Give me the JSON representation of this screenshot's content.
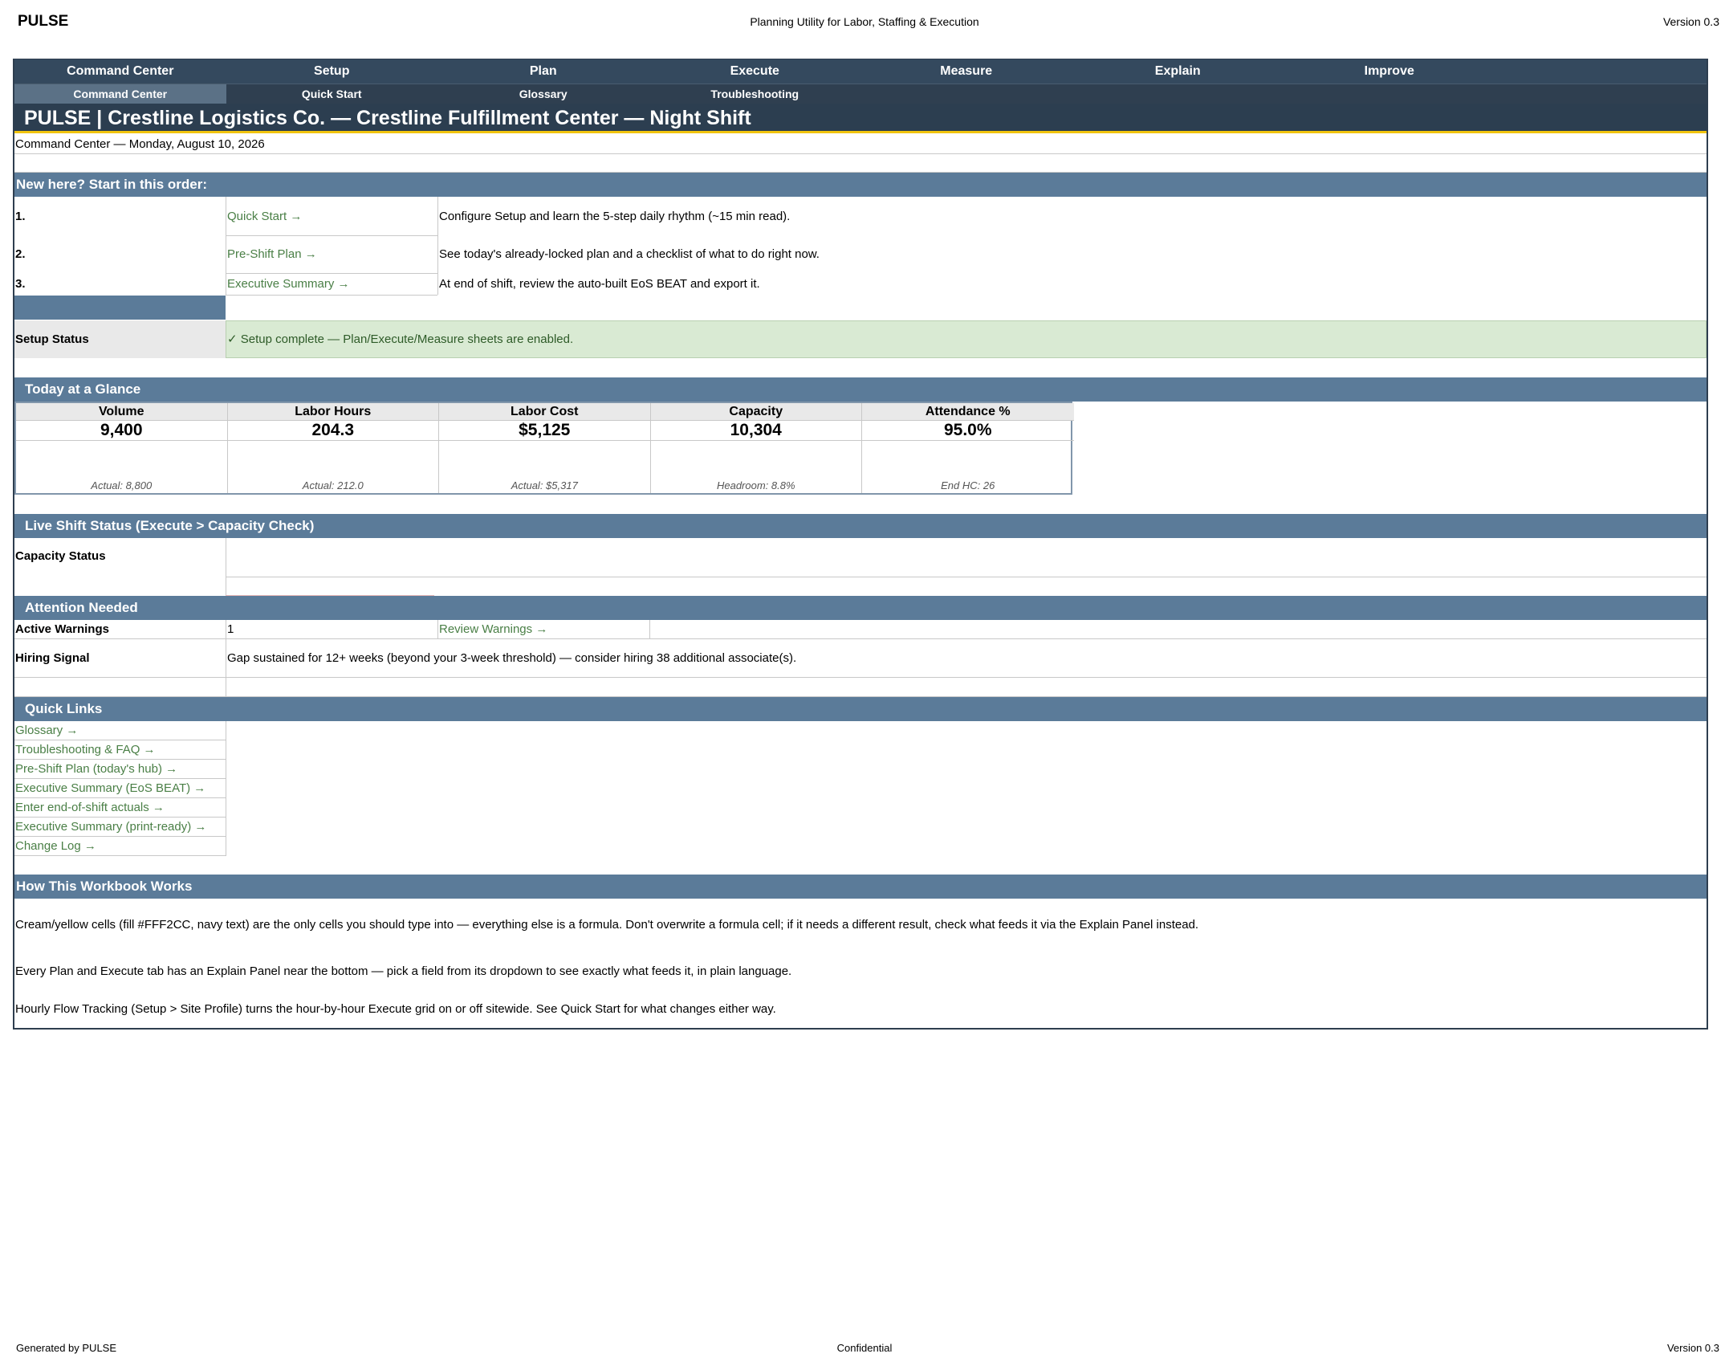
{
  "page_header": {
    "brand": "PULSE",
    "subtitle": "Planning Utility for Labor, Staffing & Execution",
    "version": "Version 0.3"
  },
  "page_footer": {
    "left": "Generated by PULSE",
    "center": "Confidential",
    "right": "Version 0.3"
  },
  "nav_primary": [
    "Command Center",
    "Setup",
    "Plan",
    "Execute",
    "Measure",
    "Explain",
    "Improve"
  ],
  "nav_secondary": [
    "Command Center",
    "Quick Start",
    "Glossary",
    "Troubleshooting"
  ],
  "nav_secondary_active": "Command Center",
  "title": "PULSE | Crestline Logistics Co. — Crestline Fulfillment Center — Night Shift",
  "date_line": "Command Center — Monday, August 10, 2026",
  "start_here": {
    "heading": "New here? Start in this order:",
    "steps": [
      {
        "num": "1.",
        "link": "Quick Start →",
        "desc": "Configure Setup and learn the 5-step daily rhythm (~15 min read)."
      },
      {
        "num": "2.",
        "link": "Pre-Shift Plan →",
        "desc": "See today's already-locked plan and a checklist of what to do right now."
      },
      {
        "num": "3.",
        "link": "Executive Summary →",
        "desc": "At end of shift, review the auto-built EoS BEAT and export it."
      }
    ]
  },
  "setup_status": {
    "label": "Setup Status",
    "value": "✓ Setup complete — Plan/Execute/Measure sheets are enabled."
  },
  "glance": {
    "heading": "Today at a Glance",
    "cards": [
      {
        "label": "Volume",
        "value": "9,400",
        "sub": "Actual: 8,800"
      },
      {
        "label": "Labor Hours",
        "value": "204.3",
        "sub": "Actual: 212.0"
      },
      {
        "label": "Labor Cost",
        "value": "$5,125",
        "sub": "Actual: $5,317"
      },
      {
        "label": "Capacity",
        "value": "10,304",
        "sub": "Headroom: 8.8%"
      },
      {
        "label": "Attendance %",
        "value": "95.0%",
        "sub": "End HC: 26"
      }
    ]
  },
  "live_status": {
    "heading": "Live Shift Status (Execute > Capacity Check)",
    "label": "Capacity Status"
  },
  "attention": {
    "heading": "Attention Needed",
    "warnings_label": "Active Warnings",
    "warnings_count": "1",
    "warnings_link": "Review Warnings →",
    "hiring_label": "Hiring Signal",
    "hiring_text": "Gap sustained for 12+ weeks (beyond your 3-week threshold) — consider hiring 38 additional associate(s)."
  },
  "quick_links": {
    "heading": "Quick Links",
    "items": [
      "Glossary →",
      "Troubleshooting & FAQ →",
      "Pre-Shift Plan (today's hub) →",
      "Executive Summary (EoS BEAT) →",
      "Enter end-of-shift actuals →",
      "Executive Summary (print-ready) →",
      "Change Log →"
    ]
  },
  "how_it_works": {
    "heading": "How This Workbook Works",
    "paragraphs": [
      "Cream/yellow cells (fill #FFF2CC, navy text) are the only cells you should type into — everything else is a formula. Don't overwrite a formula cell; if it needs a different result, check what feeds it via the Explain Panel instead.",
      "Every Plan and Execute tab has an Explain Panel near the bottom — pick a field from its dropdown to see exactly what feeds it, in plain language.",
      "Hourly Flow Tracking (Setup > Site Profile) turns the hour-by-hour Execute grid on or off sitewide. See Quick Start for what changes either way."
    ]
  },
  "colors": {
    "nav": "#34495e",
    "title_bar": "#2c3e50",
    "section_header": "#5b7b99",
    "accent": "#f1c40f",
    "link": "#4a7f46",
    "success_fill": "#d9ead3"
  }
}
